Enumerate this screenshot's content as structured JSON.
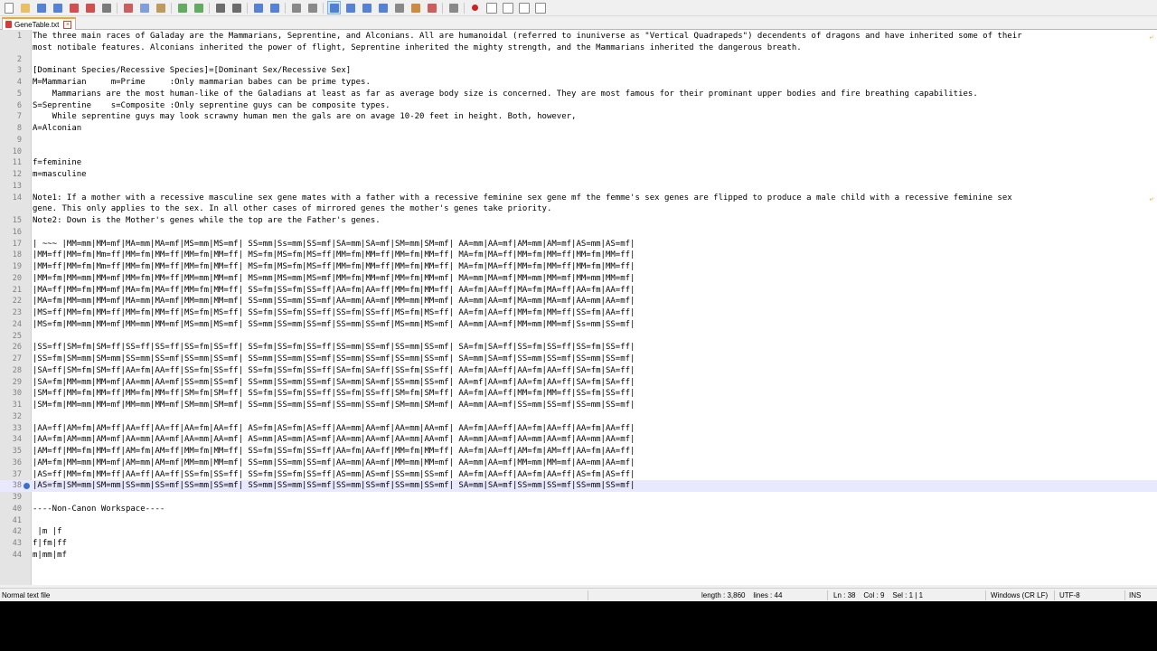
{
  "toolbar": {
    "icons": [
      "new-file-icon",
      "open-file-icon",
      "save-icon",
      "save-all-icon",
      "close-icon",
      "close-all-icon",
      "print-icon",
      "cut-icon",
      "copy-icon",
      "paste-icon",
      "undo-icon",
      "redo-icon",
      "find-icon",
      "replace-icon",
      "zoom-in-icon",
      "zoom-out-icon",
      "sync-vertical-icon",
      "sync-horizontal-icon",
      "word-wrap-icon",
      "show-all-chars-icon",
      "indent-guide-icon",
      "user-lang-icon",
      "doc-map-icon",
      "function-list-icon",
      "folder-workspace-icon",
      "monitor-icon",
      "record-macro-icon",
      "stop-macro-icon",
      "play-macro-icon",
      "run-macro-icon",
      "save-macro-icon"
    ],
    "active_index": 18,
    "colors": {
      "new-file-icon": "#ffffff",
      "open-file-icon": "#e8b64a",
      "save-icon": "#3a6fd0",
      "save-all-icon": "#3a6fd0",
      "close-icon": "#cc3333",
      "close-all-icon": "#cc3333",
      "print-icon": "#666666",
      "cut-icon": "#c44444",
      "copy-icon": "#6b8fd6",
      "paste-icon": "#b58b45",
      "undo-icon": "#4a9d4a",
      "redo-icon": "#4a9d4a",
      "find-icon": "#555555",
      "replace-icon": "#555555",
      "zoom-in-icon": "#3a6fd0",
      "zoom-out-icon": "#3a6fd0",
      "sync-vertical-icon": "#777777",
      "sync-horizontal-icon": "#777777",
      "word-wrap-icon": "#3a6fd0",
      "show-all-chars-icon": "#3a6fd0",
      "indent-guide-icon": "#3a6fd0",
      "user-lang-icon": "#3a6fd0",
      "doc-map-icon": "#777777",
      "function-list-icon": "#c47a22",
      "folder-workspace-icon": "#c44444",
      "monitor-icon": "#777777",
      "record-macro-icon": "#cc2222",
      "stop-macro-icon": "#888888",
      "play-macro-icon": "#888888",
      "run-macro-icon": "#888888",
      "save-macro-icon": "#888888"
    }
  },
  "tab": {
    "label": "GeneTable.txt",
    "icon": "file-modified-icon",
    "close_icon": "tab-close-icon",
    "accent": "#f5a623"
  },
  "editor": {
    "current_line": 38,
    "bookmark_line": 38,
    "wrap_marks": [
      1,
      14
    ],
    "lines": [
      {
        "n": "1",
        "t": "The three main races of Galaday are the Mammarians, Seprentine, and Alconians. All are humanoidal (referred to inuniverse as \"Vertical Quadrapeds\") decendents of dragons and have inherited some of their"
      },
      {
        "n": "",
        "t": "most notibale features. Alconians inherited the power of flight, Seprentine inherited the mighty strength, and the Mammarians inherited the dangerous breath."
      },
      {
        "n": "2",
        "t": ""
      },
      {
        "n": "3",
        "t": "[Dominant Species/Recessive Species]=[Dominant Sex/Recessive Sex]"
      },
      {
        "n": "4",
        "t": "M=Mammarian     m=Prime     :Only mammarian babes can be prime types."
      },
      {
        "n": "5",
        "t": "    Mammarians are the most human-like of the Galadians at least as far as average body size is concerned. They are most famous for their prominant upper bodies and fire breathing capabilities."
      },
      {
        "n": "6",
        "t": "S=Seprentine    s=Composite :Only seprentine guys can be composite types."
      },
      {
        "n": "7",
        "t": "    While seprentine guys may look scrawny human men the gals are on avage 10-20 feet in height. Both, however,"
      },
      {
        "n": "8",
        "t": "A=Alconian"
      },
      {
        "n": "9",
        "t": ""
      },
      {
        "n": "10",
        "t": ""
      },
      {
        "n": "11",
        "t": "f=feminine"
      },
      {
        "n": "12",
        "t": "m=masculine"
      },
      {
        "n": "13",
        "t": ""
      },
      {
        "n": "14",
        "t": "Note1: If a mother with a recessive masculine sex gene mates with a father with a recessive feminine sex gene mf the femme's sex genes are flipped to produce a male child with a recessive feminine sex"
      },
      {
        "n": "",
        "t": "gene. This only applies to the sex. In all other cases of mirrored genes the mother's genes take priority."
      },
      {
        "n": "15",
        "t": "Note2: Down is the Mother's genes while the top are the Father's genes."
      },
      {
        "n": "16",
        "t": ""
      },
      {
        "n": "17",
        "t": "| ~~~ |MM=mm|MM=mf|MA=mm|MA=mf|MS=mm|MS=mf| SS=mm|Ss=mm|SS=mf|SA=mm|SA=mf|SM=mm|SM=mf| AA=mm|AA=mf|AM=mm|AM=mf|AS=mm|AS=mf|"
      },
      {
        "n": "18",
        "t": "|MM=ff|MM=fm|Mm=ff|MM=fm|MM=ff|MM=fm|MM=ff| MS=fm|MS=fm|MS=ff|MM=fm|MM=ff|MM=fm|MM=ff| MA=fm|MA=ff|MM=fm|MM=ff|MM=fm|MM=ff|"
      },
      {
        "n": "19",
        "t": "|MM=ff|MM=fm|Mm=ff|MM=fm|MM=ff|MM=fm|MM=ff| MS=fm|MS=fm|MS=ff|MM=fm|MM=ff|MM=fm|MM=ff| MA=fm|MA=ff|MM=fm|MM=ff|MM=fm|MM=ff|"
      },
      {
        "n": "20",
        "t": "|MM=fm|MM=mm|MM=mf|MM=fm|MM=ff|MM=mm|MM=mf| MS=mm|MS=mm|MS=mf|MM=fm|MM=mf|MM=fm|MM=mf| MA=mm|MA=mf|MM=mm|MM=mf|MM=mm|MM=mf|"
      },
      {
        "n": "21",
        "t": "|MA=ff|MM=fm|MM=mf|MA=fm|MA=ff|MM=fm|MM=ff| SS=fm|SS=fm|SS=ff|AA=fm|AA=ff|MM=fm|MM=ff| AA=fm|AA=ff|MA=fm|MA=ff|AA=fm|AA=ff|"
      },
      {
        "n": "22",
        "t": "|MA=fm|MM=mm|MM=mf|MA=mm|MA=mf|MM=mm|MM=mf| SS=mm|SS=mm|SS=mf|AA=mm|AA=mf|MM=mm|MM=mf| AA=mm|AA=mf|MA=mm|MA=mf|AA=mm|AA=mf|"
      },
      {
        "n": "23",
        "t": "|MS=ff|MM=fm|MM=ff|MM=fm|MM=ff|MS=fm|MS=ff| SS=fm|SS=fm|SS=ff|SS=fm|SS=ff|MS=fm|MS=ff| AA=fm|AA=ff|MM=fm|MM=ff|SS=fm|AA=ff|"
      },
      {
        "n": "24",
        "t": "|MS=fm|MM=mm|MM=mf|MM=mm|MM=mf|MS=mm|MS=mf| SS=mm|SS=mm|SS=mf|SS=mm|SS=mf|MS=mm|MS=mf| AA=mm|AA=mf|MM=mm|MM=mf|Ss=mm|SS=mf|"
      },
      {
        "n": "25",
        "t": ""
      },
      {
        "n": "26",
        "t": "|SS=ff|SM=fm|SM=ff|SS=ff|SS=ff|SS=fm|SS=ff| SS=fm|SS=fm|SS=ff|SS=mm|SS=mf|SS=mm|SS=mf| SA=fm|SA=ff|SS=fm|SS=ff|SS=fm|SS=ff|"
      },
      {
        "n": "27",
        "t": "|SS=fm|SM=mm|SM=mm|SS=mm|SS=mf|SS=mm|SS=mf| SS=mm|SS=mm|SS=mf|SS=mm|SS=mf|SS=mm|SS=mf| SA=mm|SA=mf|SS=mm|SS=mf|SS=mm|SS=mf|"
      },
      {
        "n": "28",
        "t": "|SA=ff|SM=fm|SM=ff|AA=fm|AA=ff|SS=fm|SS=ff| SS=fm|SS=fm|SS=ff|SA=fm|SA=ff|SS=fm|SS=ff| AA=fm|AA=ff|AA=fm|AA=ff|SA=fm|SA=ff|"
      },
      {
        "n": "29",
        "t": "|SA=fm|MM=mm|MM=mf|AA=mm|AA=mf|SS=mm|SS=mf| SS=mm|SS=mm|SS=mf|SA=mm|SA=mf|SS=mm|SS=mf| AA=mf|AA=mf|AA=fm|AA=ff|SA=fm|SA=ff|"
      },
      {
        "n": "30",
        "t": "|SM=ff|MM=fm|MM=ff|MM=fm|MM=ff|SM=fm|SM=ff| SS=fm|SS=fm|SS=ff|SS=fm|SS=ff|SM=fm|SM=ff| AA=fm|AA=ff|MM=fm|MM=ff|SS=fm|SS=ff|"
      },
      {
        "n": "31",
        "t": "|SM=fm|MM=mm|MM=mf|MM=mm|MM=mf|SM=mm|SM=mf| SS=mm|SS=mm|SS=mf|SS=mm|SS=mf|SM=mm|SM=mf| AA=mm|AA=mf|SS=mm|SS=mf|SS=mm|SS=mf|"
      },
      {
        "n": "32",
        "t": ""
      },
      {
        "n": "33",
        "t": "|AA=ff|AM=fm|AM=ff|AA=ff|AA=ff|AA=fm|AA=ff| AS=fm|AS=fm|AS=ff|AA=mm|AA=mf|AA=mm|AA=mf| AA=fm|AA=ff|AA=fm|AA=ff|AA=fm|AA=ff|"
      },
      {
        "n": "34",
        "t": "|AA=fm|AM=mm|AM=mf|AA=mm|AA=mf|AA=mm|AA=mf| AS=mm|AS=mm|AS=mf|AA=mm|AA=mf|AA=mm|AA=mf| AA=mm|AA=mf|AA=mm|AA=mf|AA=mm|AA=mf|"
      },
      {
        "n": "35",
        "t": "|AM=ff|MM=fm|MM=ff|AM=fm|AM=ff|MM=fm|MM=ff| SS=fm|SS=fm|SS=ff|AA=fm|AA=ff|MM=fm|MM=ff| AA=fm|AA=ff|AM=fm|AM=ff|AA=fm|AA=ff|"
      },
      {
        "n": "36",
        "t": "|AM=fm|MM=mm|MM=mf|AM=mm|AM=mf|MM=mm|MM=mf| SS=mm|SS=mm|SS=mf|AA=mm|AA=mf|MM=mm|MM=mf| AA=mm|AA=mf|MM=mm|MM=mf|AA=mm|AA=mf|"
      },
      {
        "n": "37",
        "t": "|AS=ff|MM=fm|MM=ff|AA=ff|AA=ff|SS=fm|SS=ff| SS=fm|SS=fm|SS=ff|AS=mm|AS=mf|SS=mm|SS=mf| AA=fm|AA=ff|AA=fm|AA=ff|AS=fm|AS=ff|"
      },
      {
        "n": "38",
        "t": "|AS=fm|SM=mm|SM=mm|SS=mm|SS=mf|SS=mm|SS=mf| SS=mm|SS=mm|SS=mf|SS=mm|SS=mf|SS=mm|SS=mf| SA=mm|SA=mf|SS=mm|SS=mf|SS=mm|SS=mf|"
      },
      {
        "n": "39",
        "t": ""
      },
      {
        "n": "40",
        "t": "----Non-Canon Workspace----"
      },
      {
        "n": "41",
        "t": ""
      },
      {
        "n": "42",
        "t": " |m |f"
      },
      {
        "n": "43",
        "t": "f|fm|ff"
      },
      {
        "n": "44",
        "t": "m|mm|mf"
      }
    ]
  },
  "status": {
    "type": "Normal text file",
    "length": "length : 3,860    lines : 44",
    "position": "Ln : 38    Col : 9    Sel : 1 | 1",
    "eol": "Windows (CR LF)",
    "encoding": "UTF-8",
    "mode": "INS"
  }
}
